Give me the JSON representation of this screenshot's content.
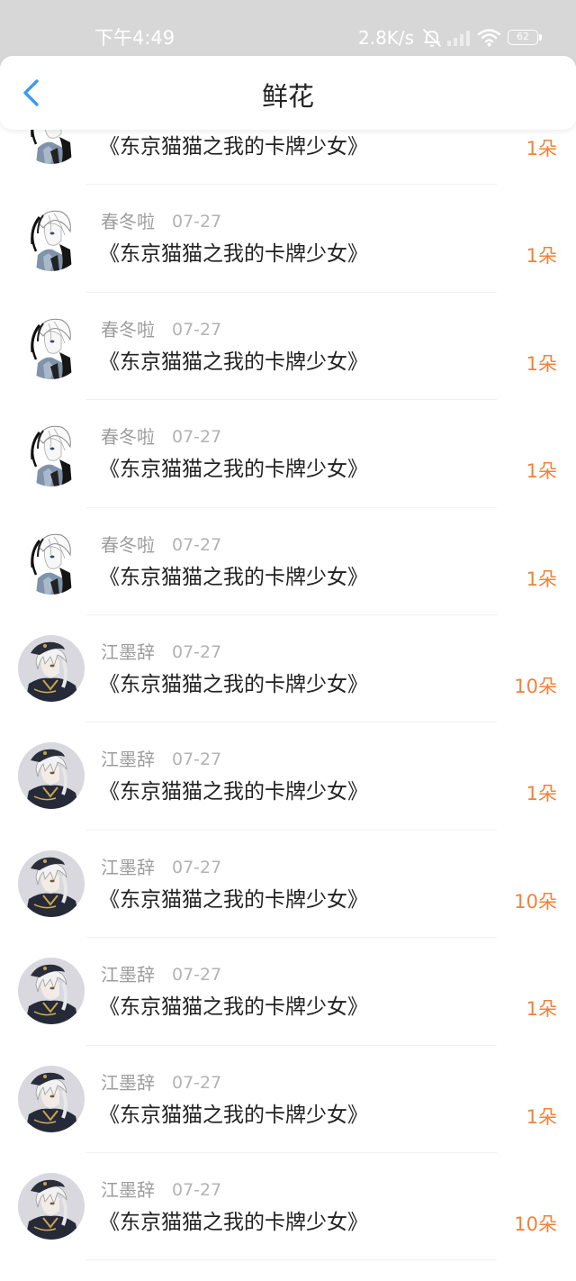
{
  "status_bar": {
    "time": "下午4:49",
    "net_speed": "2.8K/s",
    "battery": "62",
    "icons": [
      "bell-muted-icon",
      "signal-icon",
      "wifi-icon",
      "battery-icon"
    ]
  },
  "header": {
    "back_icon": "chevron-left-icon",
    "title": "鲜花"
  },
  "colors": {
    "accent": "#3a9bf0",
    "amount": "#f0823a",
    "status_bar_bg": "#d7d7d7"
  },
  "list": {
    "items": [
      {
        "avatar": "avatar-white-hair-blue",
        "title": "《东京猫猫之我的卡牌少女》",
        "amount": "1朵"
      },
      {
        "avatar": "avatar-white-hair-blue",
        "name": "春冬啦",
        "date": "07-27",
        "title": "《东京猫猫之我的卡牌少女》",
        "amount": "1朵"
      },
      {
        "avatar": "avatar-white-hair-blue",
        "name": "春冬啦",
        "date": "07-27",
        "title": "《东京猫猫之我的卡牌少女》",
        "amount": "1朵"
      },
      {
        "avatar": "avatar-white-hair-blue",
        "name": "春冬啦",
        "date": "07-27",
        "title": "《东京猫猫之我的卡牌少女》",
        "amount": "1朵"
      },
      {
        "avatar": "avatar-white-hair-blue",
        "name": "春冬啦",
        "date": "07-27",
        "title": "《东京猫猫之我的卡牌少女》",
        "amount": "1朵"
      },
      {
        "avatar": "avatar-white-hair-dark-coat",
        "name": "江墨辞",
        "date": "07-27",
        "title": "《东京猫猫之我的卡牌少女》",
        "amount": "10朵"
      },
      {
        "avatar": "avatar-white-hair-dark-coat",
        "name": "江墨辞",
        "date": "07-27",
        "title": "《东京猫猫之我的卡牌少女》",
        "amount": "1朵"
      },
      {
        "avatar": "avatar-white-hair-dark-coat",
        "name": "江墨辞",
        "date": "07-27",
        "title": "《东京猫猫之我的卡牌少女》",
        "amount": "10朵"
      },
      {
        "avatar": "avatar-white-hair-dark-coat",
        "name": "江墨辞",
        "date": "07-27",
        "title": "《东京猫猫之我的卡牌少女》",
        "amount": "1朵"
      },
      {
        "avatar": "avatar-white-hair-dark-coat",
        "name": "江墨辞",
        "date": "07-27",
        "title": "《东京猫猫之我的卡牌少女》",
        "amount": "1朵"
      },
      {
        "avatar": "avatar-white-hair-dark-coat",
        "name": "江墨辞",
        "date": "07-27",
        "title": "《东京猫猫之我的卡牌少女》",
        "amount": "10朵"
      }
    ]
  }
}
